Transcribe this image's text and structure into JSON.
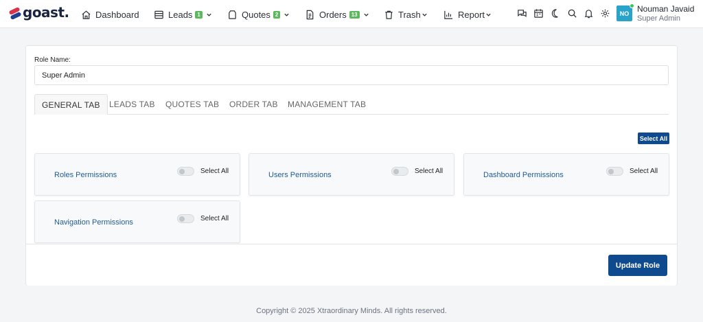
{
  "brand": {
    "name": "goast."
  },
  "nav": {
    "dashboard": "Dashboard",
    "leads": "Leads",
    "leads_badge": "1",
    "quotes": "Quotes",
    "quotes_badge": "2",
    "orders": "Orders",
    "orders_badge": "13",
    "trash": "Trash",
    "report": "Report"
  },
  "user": {
    "initials": "NO",
    "name": "Nouman Javaid",
    "role": "Super Admin"
  },
  "form": {
    "role_label": "Role Name:",
    "role_value": "Super Admin"
  },
  "tabs": [
    "GENERAL TAB",
    "LEADS TAB",
    "QUOTES TAB",
    "ORDER TAB",
    "MANAGEMENT TAB"
  ],
  "select_all_button": "Select All",
  "permissions": [
    {
      "title": "Roles Permissions",
      "select_all": "Select All",
      "enabled": false
    },
    {
      "title": "Users Permissions",
      "select_all": "Select All",
      "enabled": false
    },
    {
      "title": "Dashboard Permissions",
      "select_all": "Select All",
      "enabled": false
    },
    {
      "title": "Navigation Permissions",
      "select_all": "Select All",
      "enabled": false
    }
  ],
  "update_button": "Update Role",
  "footer": {
    "copyright": "Copyright © 2025 Xtraordinary Minds. All rights reserved."
  },
  "colors": {
    "primary": "#0f4a8f",
    "badge": "#5cb85c",
    "avatar": "#2aa3c9",
    "link": "#1f5a96"
  }
}
